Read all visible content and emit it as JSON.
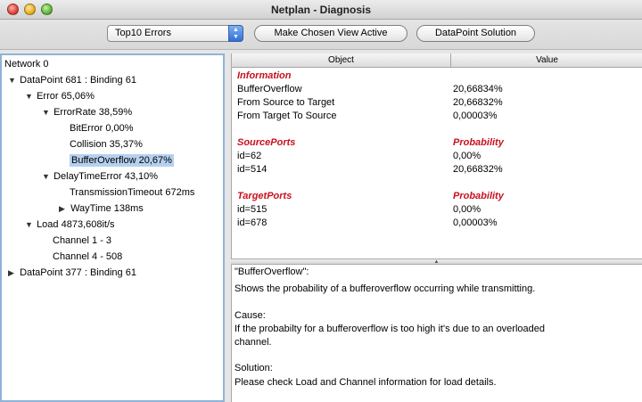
{
  "window": {
    "title": "Netplan - Diagnosis"
  },
  "toolbar": {
    "view_select_value": "Top10 Errors",
    "make_active_label": "Make Chosen View Active",
    "solution_label": "DataPoint Solution"
  },
  "tree": {
    "root": "Network 0",
    "dp681": "DataPoint 681 : Binding 61",
    "error": "Error 65,06%",
    "error_rate": "ErrorRate 38,59%",
    "bit_error": "BitError 0,00%",
    "collision": "Collision 35,37%",
    "buffer_overflow": "BufferOverflow 20,67%",
    "delay_time_error": "DelayTimeError 43,10%",
    "transmission_timeout": "TransmissionTimeout 672ms",
    "way_time": "WayTime 138ms",
    "load": "Load 4873,608it/s",
    "channel_1": "Channel 1 - 3",
    "channel_2": "Channel 4 - 508",
    "dp377": "DataPoint 377 : Binding 61"
  },
  "table": {
    "col_object": "Object",
    "col_value": "Value",
    "information": "Information",
    "rows_info": [
      {
        "object": "BufferOverflow",
        "value": "20,66834%"
      },
      {
        "object": "From Source to Target",
        "value": "20,66832%"
      },
      {
        "object": "From Target To Source",
        "value": "0,00003%"
      }
    ],
    "source_ports": "SourcePorts",
    "probability": "Probability",
    "rows_source": [
      {
        "object": "id=62",
        "value": "0,00%"
      },
      {
        "object": "id=514",
        "value": "20,66832%"
      }
    ],
    "target_ports": "TargetPorts",
    "rows_target": [
      {
        "object": "id=515",
        "value": "0,00%"
      },
      {
        "object": "id=678",
        "value": "0,00003%"
      }
    ]
  },
  "description": {
    "lines": [
      "\"BufferOverflow\":",
      " Shows the probability of a bufferoverflow occurring while transmitting.",
      "",
      "Cause:",
      " If the probabilty for a bufferoverflow is too high it's due to an overloaded",
      "channel.",
      "",
      "Solution:",
      " Please check Load and Channel information for load details."
    ]
  },
  "colors": {
    "section_red": "#c8101e",
    "selection": "#b6d0ef",
    "panel_border": "#8fb3d9"
  }
}
